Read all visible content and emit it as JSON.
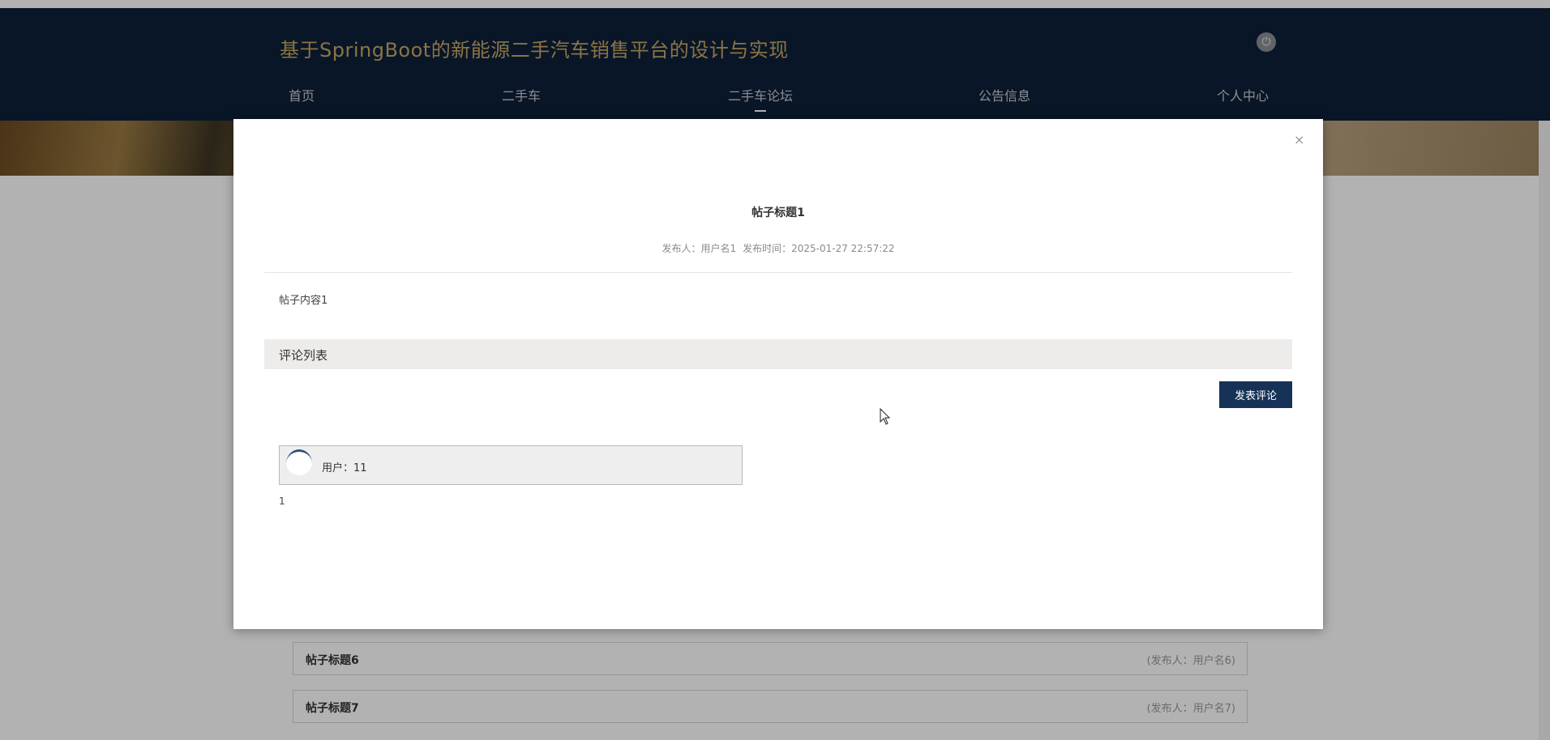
{
  "header": {
    "site_title": "基于SpringBoot的新能源二手汽车销售平台的设计与实现",
    "nav": [
      {
        "label": "首页"
      },
      {
        "label": "二手车"
      },
      {
        "label": "二手车论坛",
        "active": true
      },
      {
        "label": "公告信息"
      },
      {
        "label": "个人中心"
      }
    ],
    "power_icon": "power-icon"
  },
  "post_list": [
    {
      "title": "帖子标题6",
      "author": "(发布人：用户名6)"
    },
    {
      "title": "帖子标题7",
      "author": "(发布人：用户名7)"
    }
  ],
  "modal": {
    "close_glyph": "×",
    "post_title": "帖子标题1",
    "author_text": "发布人：用户名1",
    "time_text": "发布时间：2025-01-27 22:57:22",
    "content": "帖子内容1",
    "comment_section_label": "评论列表",
    "post_comment_button": "发表评论",
    "comments": [
      {
        "user": "用户：11",
        "text": "1"
      }
    ]
  },
  "colors": {
    "header_bg": "#0d2038",
    "title_gold": "#c7a664",
    "button_bg": "#163256"
  }
}
